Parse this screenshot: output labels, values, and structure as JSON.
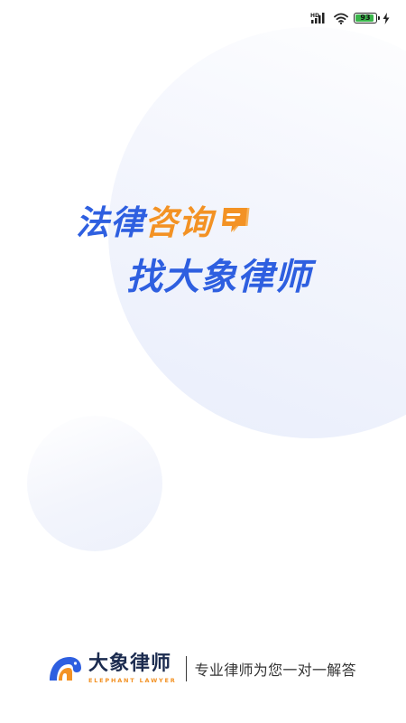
{
  "status_bar": {
    "network_label": "HD",
    "battery_level": "93",
    "battery_fraction": 0.93,
    "icons": [
      "signal-icon",
      "wifi-icon",
      "battery-icon",
      "charging-icon"
    ]
  },
  "slogan": {
    "line1_part1": "法律",
    "line1_part2": "咨询",
    "line2": "找大象律师"
  },
  "brand": {
    "name": "大象律师",
    "english": "ELEPHANT LAWYER",
    "tagline": "专业律师为您一对一解答"
  },
  "colors": {
    "primary_blue": "#2e5fe0",
    "accent_orange": "#f39224",
    "brand_navy": "#1b2b4f",
    "battery_green": "#39b54a"
  }
}
